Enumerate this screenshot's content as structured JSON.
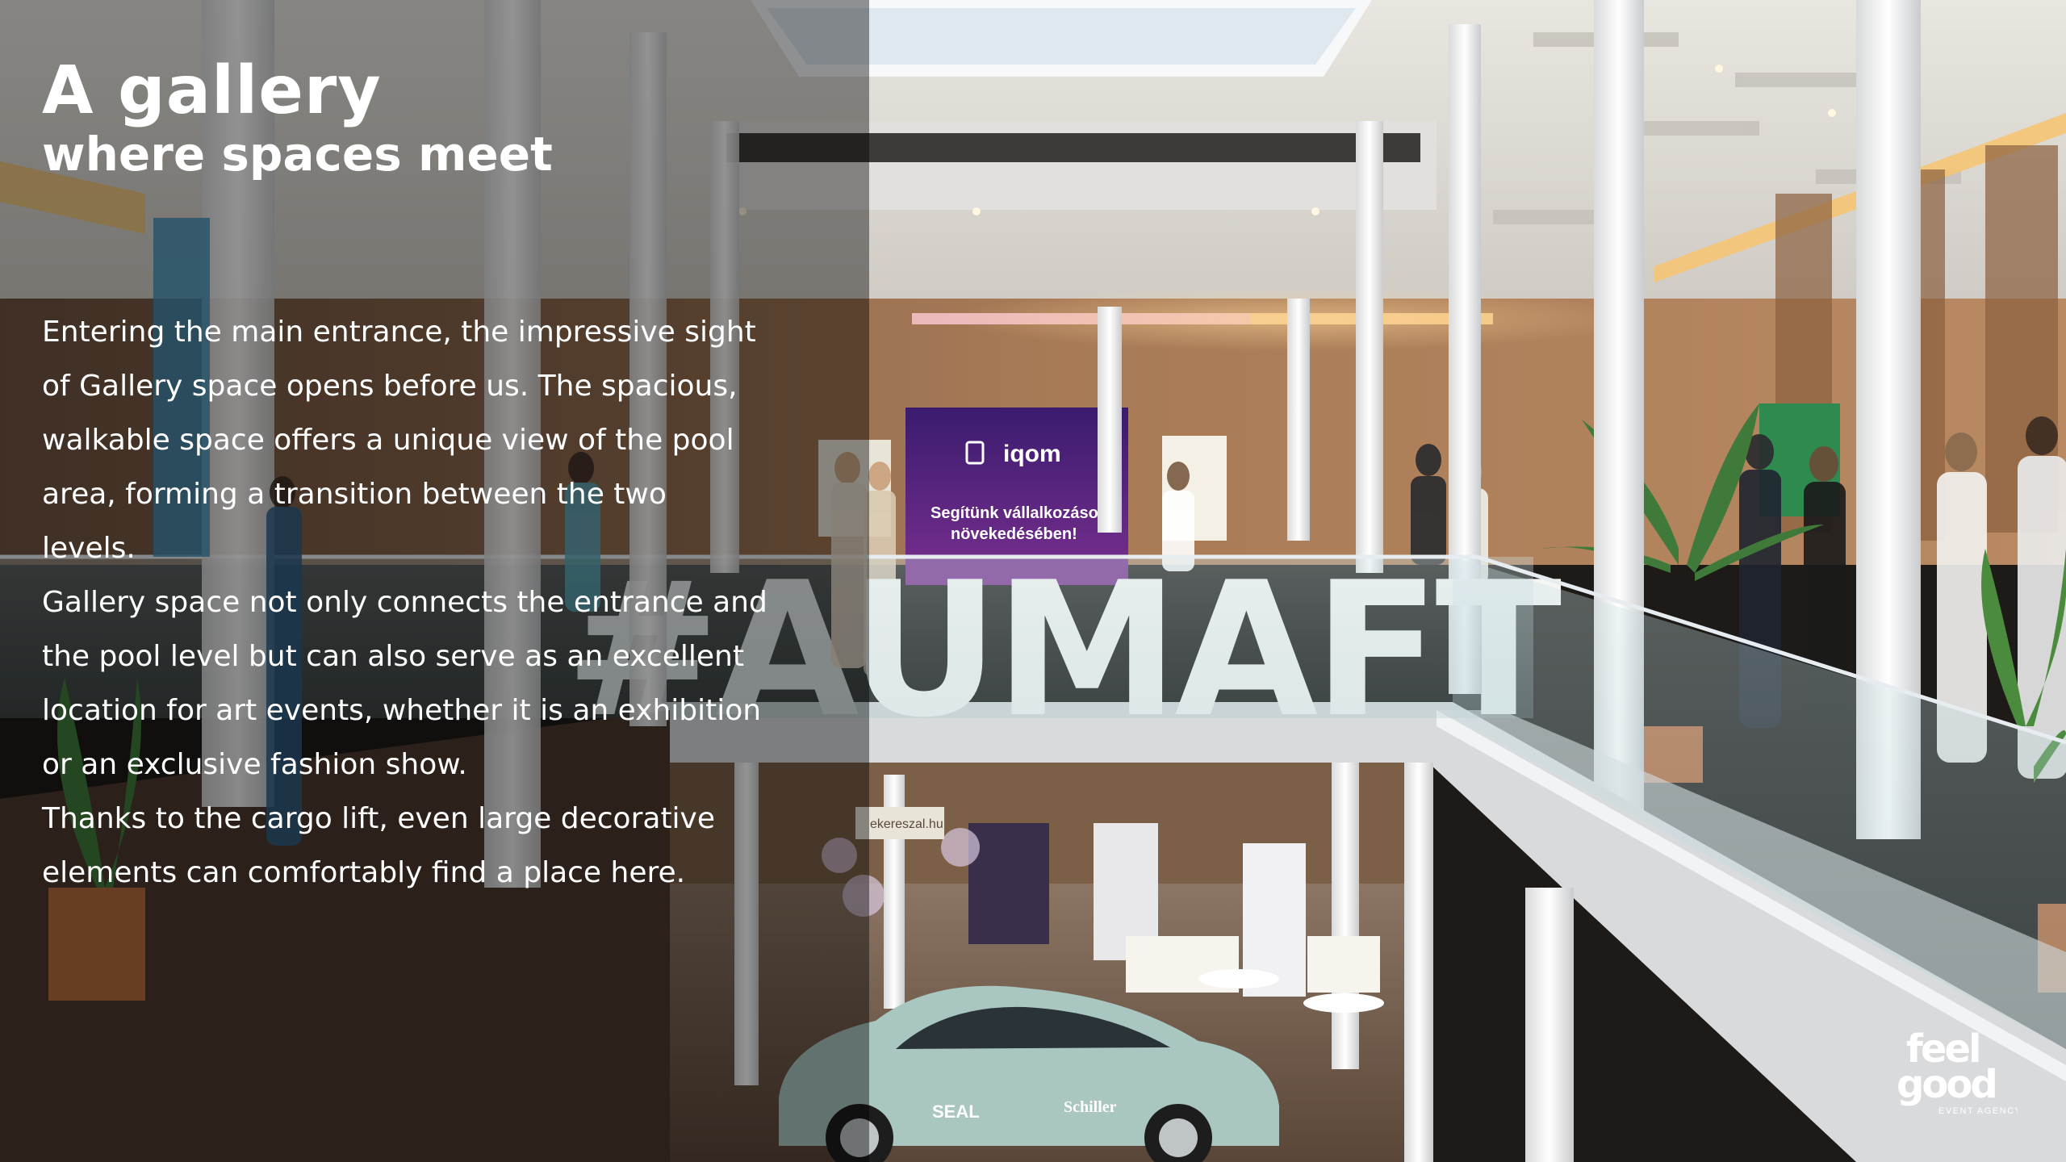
{
  "title": "A gallery",
  "subtitle": "where spaces meet",
  "paragraphs": [
    "Entering the main entrance, the impressive sight of Gallery space opens before us. The spacious, walkable space offers a unique view of the pool area, forming a transition between the two levels.",
    "Gallery space not only connects the entrance and the pool level but can also serve as an excellent location for art events, whether it is an exhibition or an exclusive fashion show.",
    "Thanks to the cargo lift, even large decorative elements can comfortably find a place here."
  ],
  "photo_text": {
    "banner_brand": "iqom",
    "banner_line1": "Segítünk vállalkozásod",
    "banner_line2": "növekedésében!",
    "railing_letters": "#AUMAFT",
    "car_model": "SEAL",
    "car_sponsor": "Schiller",
    "booth_sign": "ekereszal.hu"
  },
  "logo": {
    "line1": "feel",
    "line2": "good",
    "tagline": "EVENT AGENCY"
  },
  "colors": {
    "text": "#ffffff",
    "banner_purple": "#5b2a8c",
    "car_mint": "#a9c6c0",
    "warm_light": "#f3b15b",
    "wood_wall": "#9a6b48"
  }
}
